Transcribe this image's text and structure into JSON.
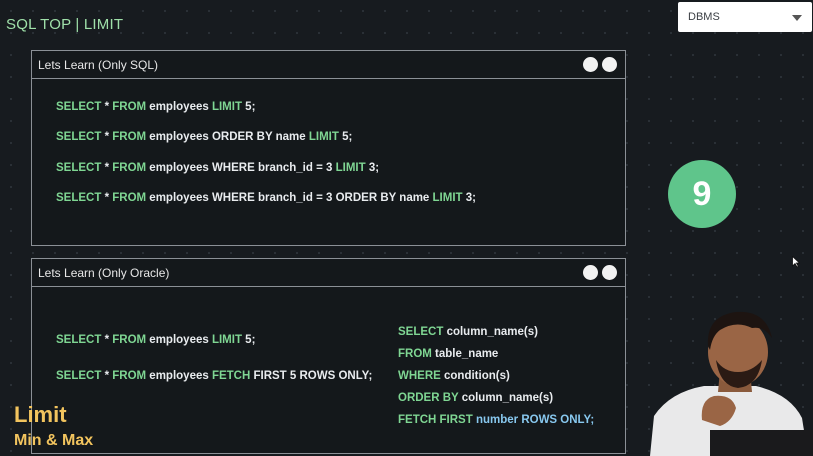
{
  "header": {
    "title": "SQL TOP | LIMIT"
  },
  "course_dropdown": {
    "selected": "DBMS",
    "icon": "chevron-down-icon"
  },
  "panel_sql": {
    "title": "Lets Learn (Only SQL)",
    "lines": [
      [
        {
          "t": "SELECT",
          "k": "kw"
        },
        {
          "t": " * "
        },
        {
          "t": "FROM",
          "k": "kw"
        },
        {
          "t": " employees "
        },
        {
          "t": "LIMIT",
          "k": "kw"
        },
        {
          "t": " 5;"
        }
      ],
      [
        {
          "t": "SELECT",
          "k": "kw"
        },
        {
          "t": " * "
        },
        {
          "t": "FROM",
          "k": "kw"
        },
        {
          "t": " employees ORDER BY name "
        },
        {
          "t": "LIMIT",
          "k": "kw"
        },
        {
          "t": " 5;"
        }
      ],
      [
        {
          "t": "SELECT",
          "k": "kw"
        },
        {
          "t": " * "
        },
        {
          "t": "FROM",
          "k": "kw"
        },
        {
          "t": " employees WHERE branch_id = 3 "
        },
        {
          "t": "LIMIT",
          "k": "kw"
        },
        {
          "t": " 3;"
        }
      ],
      [
        {
          "t": "SELECT",
          "k": "kw"
        },
        {
          "t": " * "
        },
        {
          "t": "FROM",
          "k": "kw"
        },
        {
          "t": " employees WHERE branch_id = 3 ORDER BY name "
        },
        {
          "t": "LIMIT",
          "k": "kw"
        },
        {
          "t": " 3;"
        }
      ]
    ]
  },
  "panel_oracle": {
    "title": "Lets Learn (Only Oracle)",
    "left_lines": [
      [
        {
          "t": "SELECT",
          "k": "kw"
        },
        {
          "t": " * "
        },
        {
          "t": "FROM",
          "k": "kw"
        },
        {
          "t": " employees "
        },
        {
          "t": "LIMIT",
          "k": "kw"
        },
        {
          "t": " 5;"
        }
      ],
      [
        {
          "t": "SELECT",
          "k": "kw"
        },
        {
          "t": " * "
        },
        {
          "t": "FROM",
          "k": "kw"
        },
        {
          "t": " employees "
        },
        {
          "t": "FETCH",
          "k": "kw"
        },
        {
          "t": " FIRST 5 ROWS ONLY;"
        }
      ]
    ],
    "right_lines": [
      [
        {
          "t": "SELECT",
          "k": "kw"
        },
        {
          "t": " column_name(s)"
        }
      ],
      [
        {
          "t": "FROM",
          "k": "kw"
        },
        {
          "t": " table_name"
        }
      ],
      [
        {
          "t": "WHERE",
          "k": "kw"
        },
        {
          "t": " condition(s)"
        }
      ],
      [
        {
          "t": "ORDER BY",
          "k": "kw"
        },
        {
          "t": " column_name(s)"
        }
      ],
      [
        {
          "t": "FETCH FIRST",
          "k": "kw"
        },
        {
          "t": " number ",
          "k": "kw-blue"
        },
        {
          "t": "ROWS ONLY;",
          "k": "kw-blue"
        }
      ]
    ]
  },
  "badge": {
    "number": "9"
  },
  "lesson": {
    "title": "Limit",
    "subtitle": "Min & Max"
  },
  "colors": {
    "keyword": "#7fd693",
    "keyword_blue": "#88c8ef",
    "lesson_title": "#f2c45e",
    "badge": "#5fc58b"
  }
}
